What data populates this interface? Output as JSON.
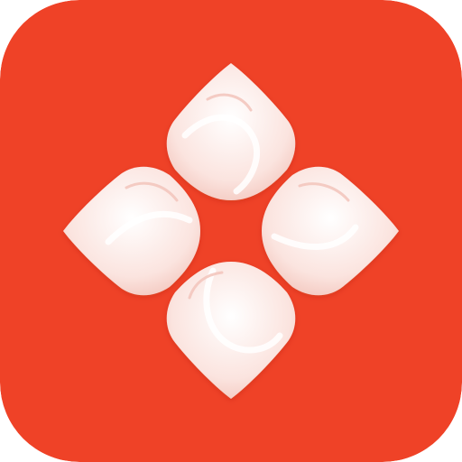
{
  "app_icon": {
    "shape": "rounded-square",
    "symbol": "four-petal-flower",
    "colors": {
      "background": "#EF4227",
      "petal_fill": "#FBE4DF",
      "petal_highlight": "#FFFFFF",
      "petal_edge": "#F3C7BE"
    }
  }
}
